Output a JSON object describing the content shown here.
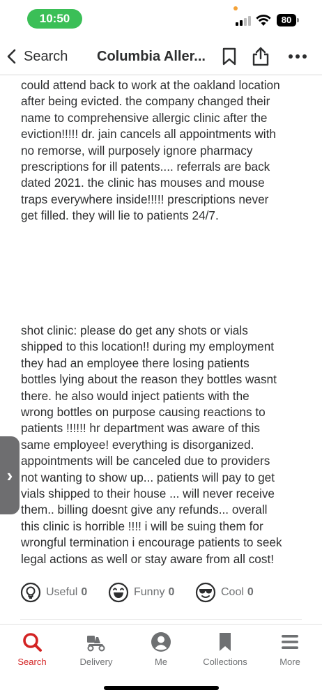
{
  "status_bar": {
    "time": "10:50",
    "battery": "80"
  },
  "nav": {
    "back_label": "Search",
    "title": "Columbia Aller..."
  },
  "reviews": [
    {
      "lines": [
        "could attend back to work at the oakland location",
        "after being evicted. the company changed their",
        "name to comprehensive allergic clinic after the",
        "eviction!!!!!  dr. jain cancels all appointments with",
        "no remorse, will purposely ignore pharmacy",
        "prescriptions for ill patents.... referrals are back",
        "dated 2021. the clinic has mouses and mouse",
        "traps everywhere inside!!!!! prescriptions never",
        "get filled. they will lie to patients 24/7."
      ]
    },
    {
      "lines": [
        "shot clinic: please do get any shots or vials",
        "shipped to this location!! during my employment",
        "they had an employee there losing patients",
        "bottles lying about the reason they bottles wasnt",
        "there. he also would inject patients with the",
        "wrong bottles on purpose causing reactions to",
        "patients !!!!!! hr department was aware of this",
        "same employee! everything is disorganized.",
        "appointments will be canceled due to providers",
        "not wanting to show up... patients will pay to get",
        "vials shipped to their house ... will never receive",
        "them.. billing doesnt give any refunds... overall",
        "this clinic is horrible !!!!  i will be suing them for",
        "wrongful termination i encourage patients to seek",
        "legal actions as well or stay aware from all cost!"
      ]
    }
  ],
  "side_tab": {
    "glyph": "›"
  },
  "reactions": [
    {
      "label": "Useful",
      "count": "0",
      "icon": "lightbulb-icon"
    },
    {
      "label": "Funny",
      "count": "0",
      "icon": "laughing-face-icon"
    },
    {
      "label": "Cool",
      "count": "0",
      "icon": "sunglasses-face-icon"
    }
  ],
  "tabs": [
    {
      "label": "Search",
      "icon": "search-icon",
      "active": true
    },
    {
      "label": "Delivery",
      "icon": "delivery-scooter-icon",
      "active": false
    },
    {
      "label": "Me",
      "icon": "profile-icon",
      "active": false
    },
    {
      "label": "Collections",
      "icon": "bookmark-icon",
      "active": false
    },
    {
      "label": "More",
      "icon": "menu-icon",
      "active": false
    }
  ],
  "colors": {
    "accent": "#d32323",
    "time_pill": "#3bbf57",
    "text": "#2d2e2f",
    "muted": "#6e7072"
  }
}
